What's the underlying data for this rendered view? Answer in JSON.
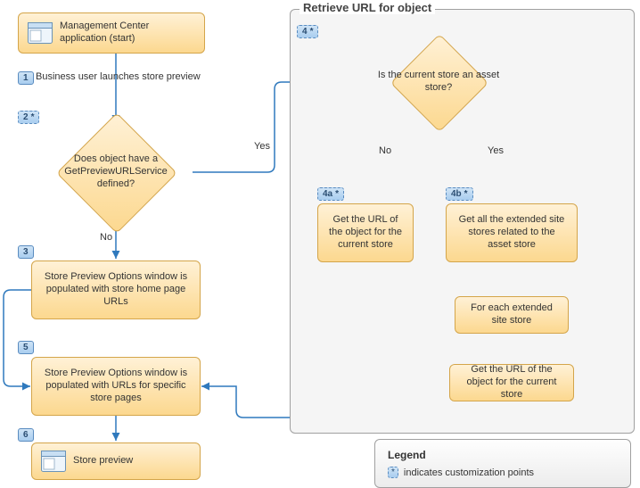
{
  "diagram": {
    "panel_title": "Retrieve URL for object",
    "nodes": {
      "start": "Management Center application (start)",
      "decision2": "Does object have a GetPreviewURLService defined?",
      "step3": "Store Preview Options window is populated with store home page URLs",
      "decision4": "Is the current store an asset store?",
      "step4a": "Get the URL of the object for the current store",
      "step4b": "Get all the extended site stores related to the asset store",
      "step4b_loop": "For each extended site store",
      "step4b_get": "Get the URL of the object for the current store",
      "step5": "Store Preview Options window is populated with URLs for specific store pages",
      "step6": "Store preview"
    },
    "badges": {
      "b1": "1",
      "b2": "2",
      "b3": "3",
      "b4": "4",
      "b4a": "4a",
      "b4b": "4b",
      "b5": "5",
      "b6": "6"
    },
    "edges": {
      "e1": "Business user launches store preview",
      "yes": "Yes",
      "no": "No"
    },
    "legend": {
      "title": "Legend",
      "star": "*",
      "text": "indicates customization points"
    }
  }
}
